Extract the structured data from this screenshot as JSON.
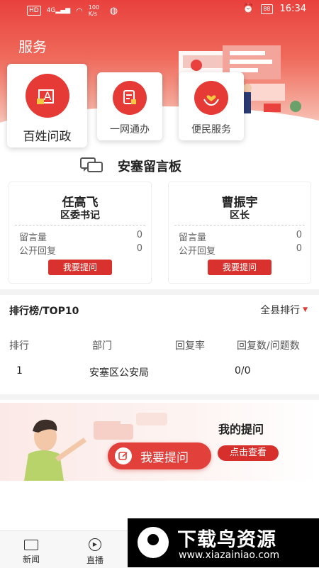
{
  "status_bar": {
    "hd": "HD",
    "signal": "4G",
    "speed": "100 K/s",
    "time": "16:34",
    "battery_label": "88"
  },
  "header": {
    "title": "服务"
  },
  "services": [
    {
      "label": "百姓问政",
      "icon": "writing-a-icon"
    },
    {
      "label": "一网通办",
      "icon": "document-pen-icon"
    },
    {
      "label": "便民服务",
      "icon": "hand-heart-icon"
    }
  ],
  "message_board": {
    "title": "安塞留言板",
    "leaders": [
      {
        "name": "任高飞",
        "position": "区委书记",
        "msg_label": "留言量",
        "msg_count": "0",
        "reply_label": "公开回复",
        "reply_count": "0",
        "ask_label": "我要提问"
      },
      {
        "name": "曹振宇",
        "position": "区长",
        "msg_label": "留言量",
        "msg_count": "0",
        "reply_label": "公开回复",
        "reply_count": "0",
        "ask_label": "我要提问"
      }
    ]
  },
  "ranking": {
    "title": "排行榜/TOP10",
    "filter": "全县排行",
    "columns": [
      "排行",
      "部门",
      "回复率",
      "回复数/问题数"
    ],
    "rows": [
      {
        "rank": "1",
        "dept": "安塞区公安局",
        "rate": "",
        "ratio": "0/0"
      }
    ]
  },
  "my_question": {
    "title": "我的提问",
    "view_label": "点击查看",
    "ask_label": "我要提问"
  },
  "bottom_nav": [
    {
      "label": "新闻",
      "icon": "newspaper-icon"
    },
    {
      "label": "直播",
      "icon": "play-icon"
    }
  ],
  "watermark": {
    "text": "下载鸟资源",
    "url": "www.xiazainiao.com"
  },
  "colors": {
    "accent": "#e53a35",
    "accent_dark": "#d9322e"
  }
}
